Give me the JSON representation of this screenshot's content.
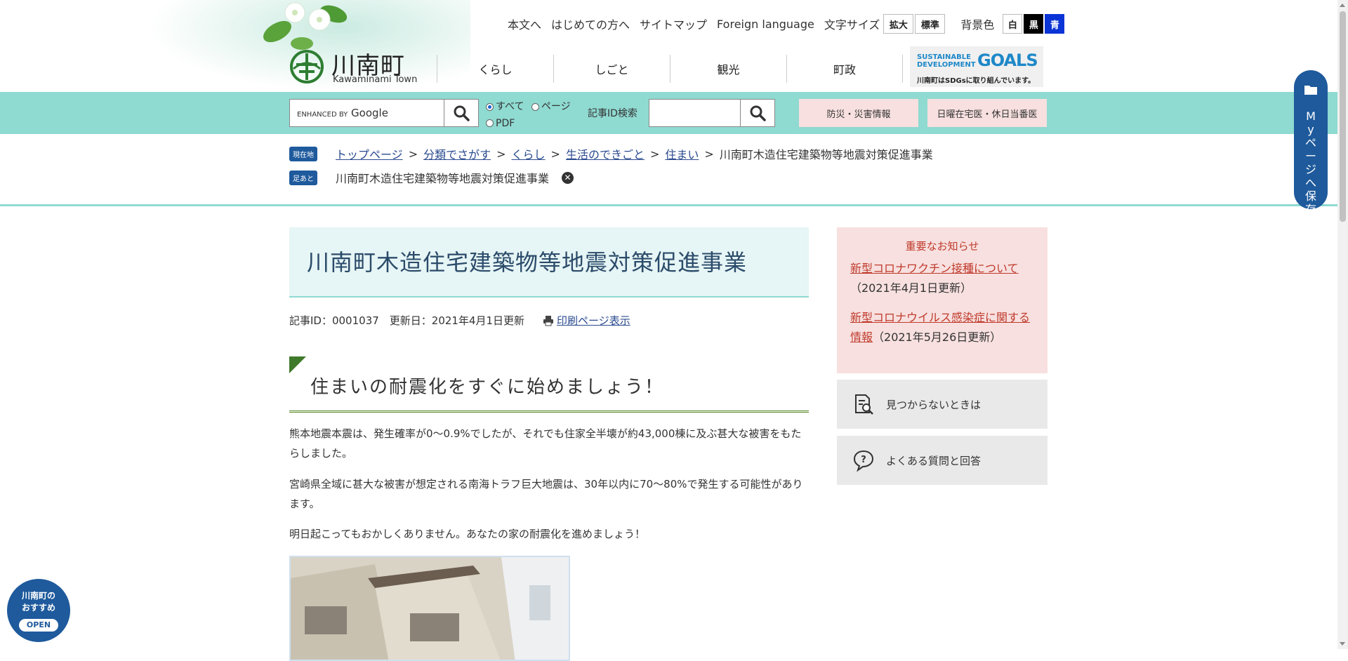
{
  "utility_nav": {
    "links": [
      "本文へ",
      "はじめての方へ",
      "サイトマップ",
      "Foreign language"
    ],
    "font_size_label": "文字サイズ",
    "font_size_buttons": [
      "拡大",
      "標準"
    ],
    "bg_label": "背景色",
    "bg_buttons": [
      "白",
      "黒",
      "青"
    ]
  },
  "logo": {
    "title": "川南町",
    "subtitle": "Kawaminami Town"
  },
  "main_nav": [
    "くらし",
    "しごと",
    "観光",
    "町政"
  ],
  "sdgs": {
    "line1": "SUSTAINABLE",
    "line2": "DEVELOPMENT",
    "goals": "GOALS",
    "caption": "川南町はSDGsに取り組んでいます。"
  },
  "search": {
    "placeholder_small": "ENHANCED BY",
    "placeholder_brand": "Google",
    "scope_options": [
      "すべて",
      "ページ",
      "PDF"
    ],
    "selected_scope": "すべて",
    "article_id_label": "記事ID検索",
    "article_id_value": ""
  },
  "quick_buttons": [
    "防災・災害情報",
    "日曜在宅医・休日当番医"
  ],
  "breadcrumb": {
    "current_tag": "現在地",
    "links": [
      "トップページ",
      "分類でさがす",
      "くらし",
      "生活のできごと",
      "住まい"
    ],
    "current": "川南町木造住宅建築物等地震対策促進事業",
    "history_tag": "足あと",
    "history_item": "川南町木造住宅建築物等地震対策促進事業"
  },
  "article": {
    "title": "川南町木造住宅建築物等地震対策促進事業",
    "id": "記事ID：0001037",
    "updated": "更新日：2021年4月1日更新",
    "print_label": "印刷ページ表示",
    "heading": "住まいの耐震化をすぐに始めましょう！",
    "paragraphs": [
      "熊本地震本震は、発生確率が0～0.9%でしたが、それでも住家全半壊が約43,000棟に及ぶ甚大な被害をもたらしました。",
      "宮崎県全域に甚大な被害が想定される南海トラフ巨大地震は、30年以内に70～80%で発生する可能性があります。",
      "明日起こってもおかしくありません。あなたの家の耐震化を進めましょう！"
    ]
  },
  "notice": {
    "heading": "重要なお知らせ",
    "items": [
      {
        "link": "新型コロナワクチン接種について",
        "date": "（2021年4月1日更新）"
      },
      {
        "link": "新型コロナウイルス感染症に関する情報",
        "date": "（2021年5月26日更新）"
      }
    ]
  },
  "side_buttons": [
    "見つからないときは",
    "よくある質問と回答"
  ],
  "mypage": {
    "label": "Myページへ保存"
  },
  "osusume": {
    "line1": "川南町の",
    "line2": "おすすめ",
    "open": "OPEN"
  },
  "colors": {
    "accent_teal": "#8fdad1",
    "navy": "#1e5a9c",
    "notice_pink": "#f7e0df",
    "notice_red": "#c0392b"
  }
}
